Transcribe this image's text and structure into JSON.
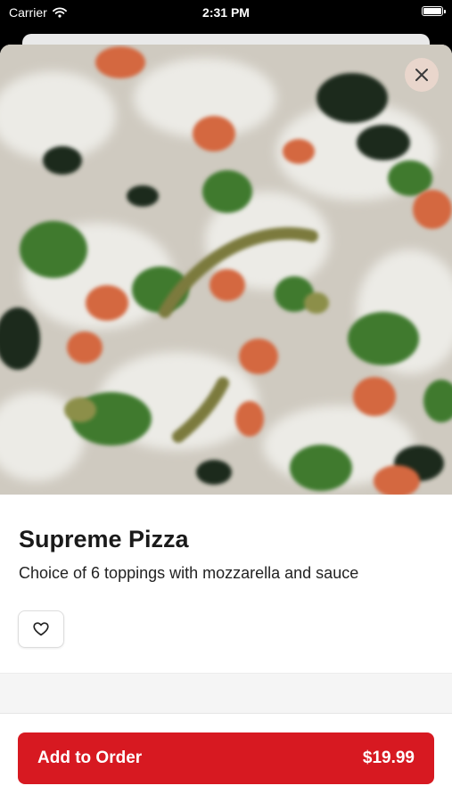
{
  "status_bar": {
    "carrier": "Carrier",
    "time": "2:31 PM",
    "wifi_icon": "wifi-icon",
    "battery_icon": "battery-icon"
  },
  "item": {
    "name": "Supreme Pizza",
    "description": "Choice of 6 toppings with mozzarella and sauce",
    "photo": "pizza-photo"
  },
  "actions": {
    "close_icon": "close-icon",
    "favorite_icon": "heart-icon",
    "add_label": "Add to Order",
    "price": "$19.99"
  },
  "colors": {
    "accent": "#d71921",
    "close_bg": "#ebd7cd"
  }
}
